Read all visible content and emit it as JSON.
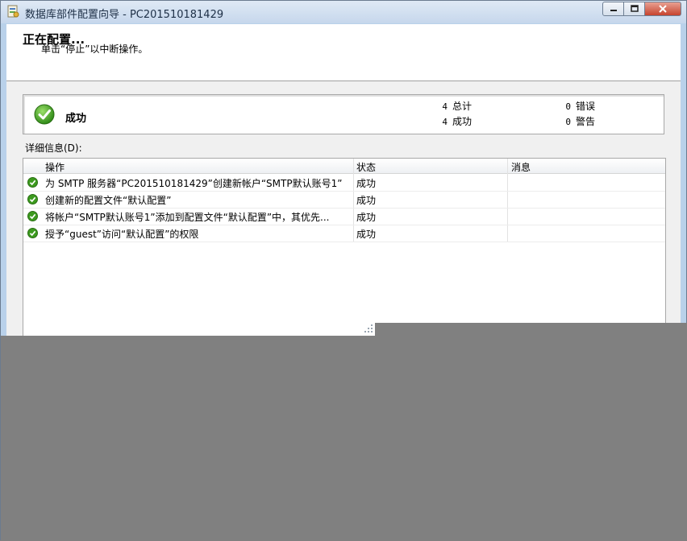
{
  "window": {
    "title": "数据库部件配置向导 - PC201510181429",
    "icons": {
      "app": "wizard-app-icon",
      "min": "minimize-icon",
      "max": "maximize-icon",
      "close": "close-icon"
    }
  },
  "header": {
    "title": "正在配置...",
    "subtitle": "单击“停止”以中断操作。"
  },
  "summary": {
    "status": "成功",
    "status_icon": "success-check-icon",
    "total_count": "4",
    "total_label": "总计",
    "success_count": "4",
    "success_label": "成功",
    "error_count": "0",
    "error_label": "错误",
    "warning_count": "0",
    "warning_label": "警告"
  },
  "details": {
    "label": "详细信息(D):",
    "columns": [
      "操作",
      "状态",
      "消息"
    ],
    "rows": [
      {
        "op": "为 SMTP 服务器“PC201510181429”创建新帐户“SMTP默认账号1”",
        "status": "成功",
        "message": ""
      },
      {
        "op": "创建新的配置文件“默认配置”",
        "status": "成功",
        "message": ""
      },
      {
        "op": "将帐户“SMTP默认账号1”添加到配置文件“默认配置”中，其优先...",
        "status": "成功",
        "message": ""
      },
      {
        "op": "授予“guest”访问“默认配置”的权限",
        "status": "成功",
        "message": ""
      }
    ]
  },
  "colors": {
    "success_green": "#3c9a1e",
    "overlay_gray": "#808080"
  }
}
